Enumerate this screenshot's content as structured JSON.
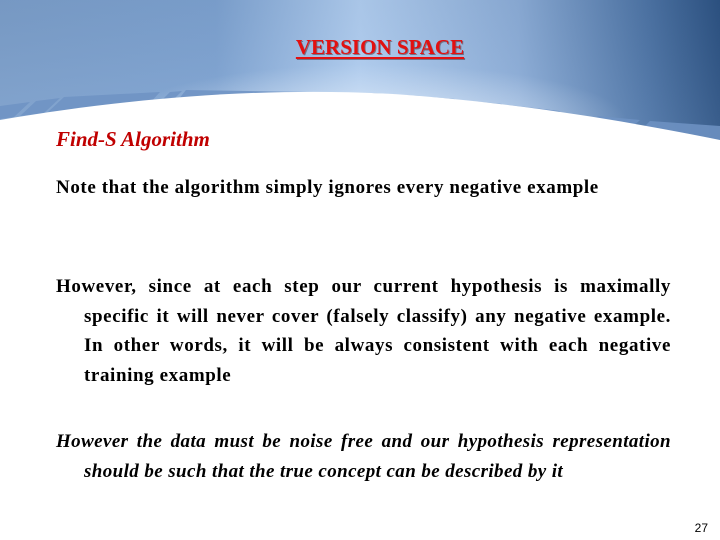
{
  "slide": {
    "title": "VERSION SPACE",
    "subtitle": "Find-S Algorithm",
    "paragraphs": [
      "Note that the algorithm simply ignores every negative example",
      "However, since at each step our current hypothesis is maximally specific it will never cover (falsely classify) any negative example. In other words, it will be always consistent with each negative training example",
      "However the data must be noise free and our hypothesis representation should be such that the true concept can be described by it"
    ],
    "page_number": "27"
  },
  "colors": {
    "title": "#e31010",
    "subtitle": "#c00000",
    "body_text": "#000000",
    "header_light": "#b9d6f7",
    "header_dark": "#2e5587"
  }
}
